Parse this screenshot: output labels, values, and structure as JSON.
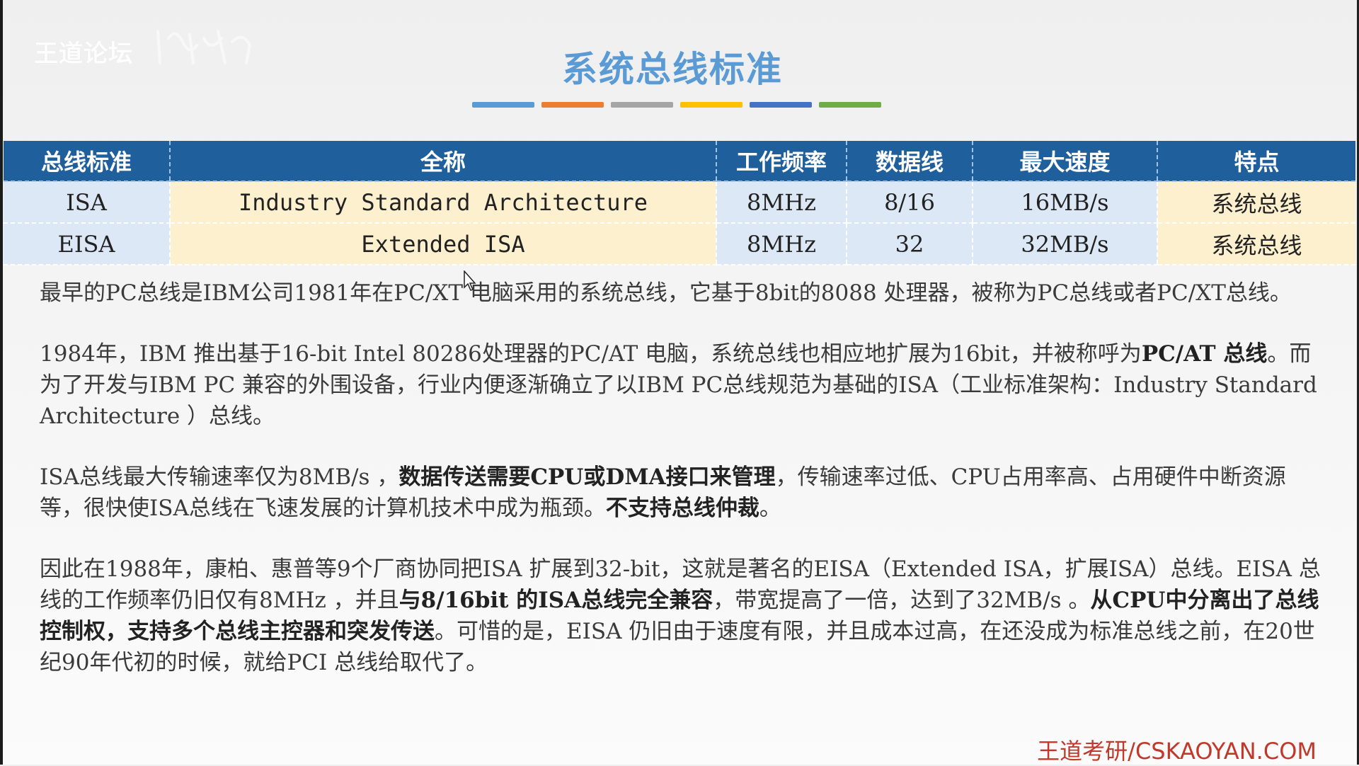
{
  "watermark": {
    "text": "王道论坛"
  },
  "title": "系统总线标准",
  "color_bar": [
    "#5b9bd5",
    "#ed7d31",
    "#a5a5a5",
    "#ffc000",
    "#4472c4",
    "#70ad47"
  ],
  "table": {
    "headers": [
      "总线标准",
      "全称",
      "工作频率",
      "数据线",
      "最大速度",
      "特点"
    ],
    "rows": [
      [
        "ISA",
        "Industry Standard Architecture",
        "8MHz",
        "8/16",
        "16MB/s",
        "系统总线"
      ],
      [
        "EISA",
        "Extended ISA",
        "8MHz",
        "32",
        "32MB/s",
        "系统总线"
      ]
    ]
  },
  "paragraphs": {
    "p1": "最早的PC总线是IBM公司1981年在PC/XT 电脑采用的系统总线，它基于8bit的8088 处理器，被称为PC总线或者PC/XT总线。",
    "p2_a": "1984年，IBM 推出基于16-bit Intel 80286处理器的PC/AT 电脑，系统总线也相应地扩展为16bit，并被称呼为",
    "p2_b": "PC/AT 总线",
    "p2_c": "。而为了开发与IBM PC 兼容的外围设备，行业内便逐渐确立了以IBM PC总线规范为基础的ISA（工业标准架构：Industry Standard Architecture ）总线。",
    "p3_a": "ISA总线最大传输速率仅为8MB/s ，",
    "p3_b": "数据传送需要CPU或DMA接口来管理",
    "p3_c": "，传输速率过低、CPU占用率高、占用硬件中断资源等，很快使ISA总线在飞速发展的计算机技术中成为瓶颈。",
    "p3_d": "不支持总线仲裁",
    "p3_e": "。",
    "p4_a": "因此在1988年，康柏、惠普等9个厂商协同把ISA 扩展到32-bit，这就是著名的EISA（Extended ISA，扩展ISA）总线。EISA 总线的工作频率仍旧仅有8MHz ，并且",
    "p4_b": "与8/16bit 的ISA总线完全兼容",
    "p4_c": "，带宽提高了一倍，达到了32MB/s 。",
    "p4_d": "从CPU中分离出了总线控制权，支持多个总线主控器和突发传送",
    "p4_e": "。可惜的是，EISA 仍旧由于速度有限，并且成本过高，在还没成为标准总线之前，在20世纪90年代初的时候，就给PCI 总线给取代了。"
  },
  "footer": "王道考研/CSKAOYAN.COM"
}
